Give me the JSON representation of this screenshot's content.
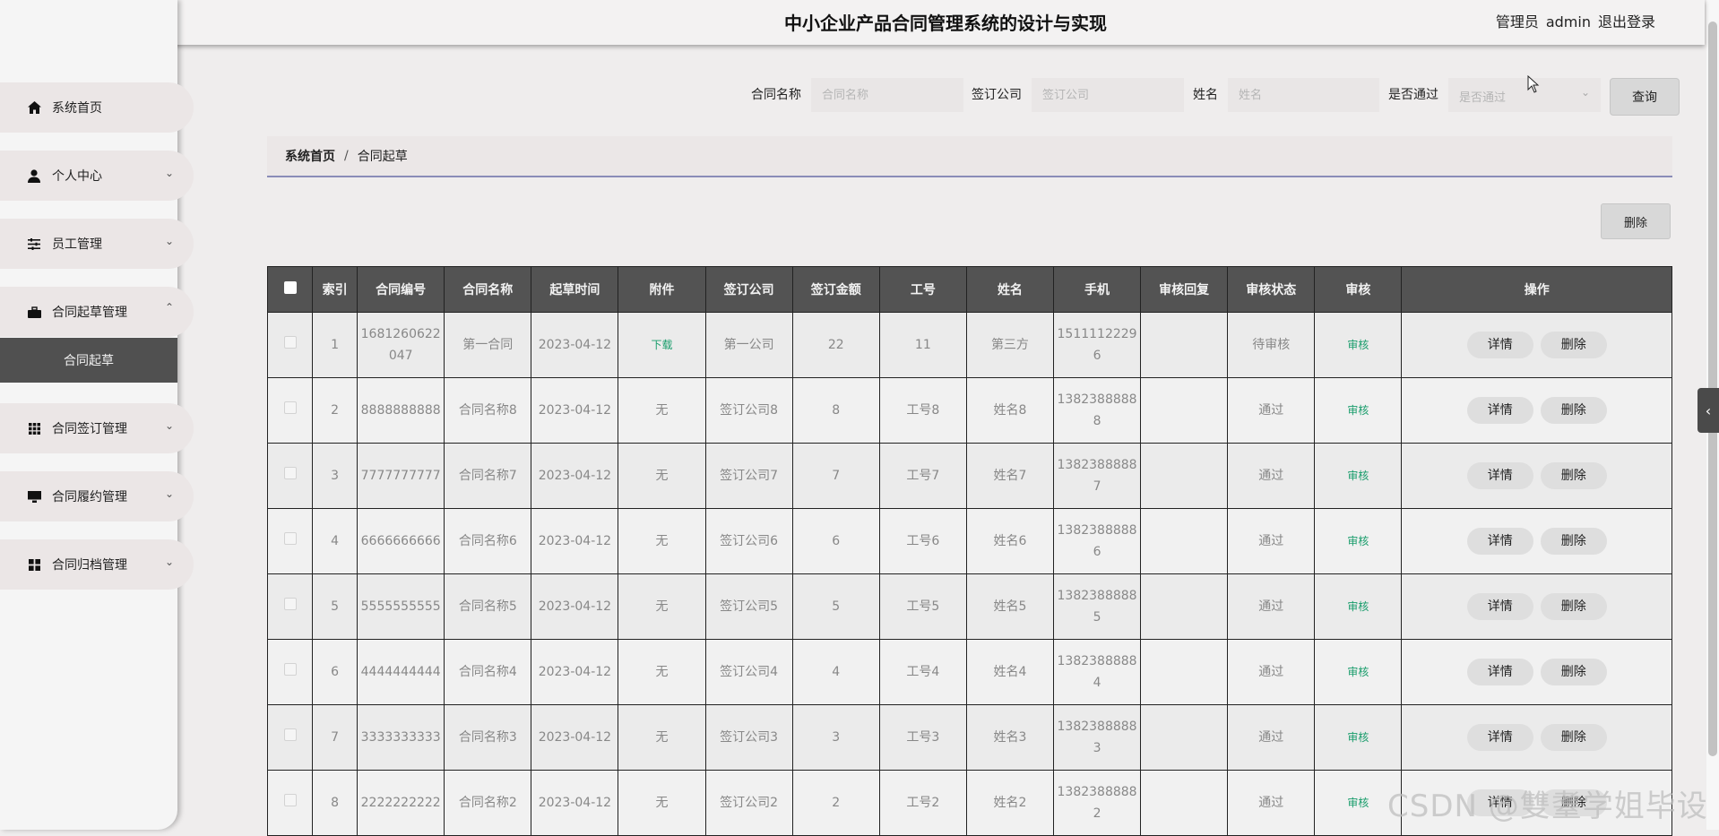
{
  "header": {
    "title": "中小企业产品合同管理系统的设计与实现",
    "user_role": "管理员",
    "user_name": "admin",
    "logout": "退出登录"
  },
  "sidebar": {
    "items": [
      {
        "label": "系统首页",
        "icon": "home-icon"
      },
      {
        "label": "个人中心",
        "icon": "user-icon"
      },
      {
        "label": "员工管理",
        "icon": "sliders-icon"
      },
      {
        "label": "合同起草管理",
        "icon": "briefcase-icon"
      },
      {
        "label": "合同签订管理",
        "icon": "grid-icon"
      },
      {
        "label": "合同履约管理",
        "icon": "monitor-icon"
      },
      {
        "label": "合同归档管理",
        "icon": "apps-icon"
      }
    ],
    "active_sub": "合同起草"
  },
  "search": {
    "contract_name_label": "合同名称",
    "contract_name_placeholder": "合同名称",
    "company_label": "签订公司",
    "company_placeholder": "签订公司",
    "name_label": "姓名",
    "name_placeholder": "姓名",
    "pass_label": "是否通过",
    "pass_placeholder": "是否通过",
    "query_button": "查询"
  },
  "breadcrumb": {
    "home": "系统首页",
    "separator": "/",
    "current": "合同起草"
  },
  "actions": {
    "delete_button": "删除"
  },
  "table": {
    "headers": [
      "索引",
      "合同编号",
      "合同名称",
      "起草时间",
      "附件",
      "签订公司",
      "签订金额",
      "工号",
      "姓名",
      "手机",
      "审核回复",
      "审核状态",
      "审核",
      "操作"
    ],
    "detail_label": "详情",
    "delete_label": "删除",
    "rows": [
      {
        "idx": "1",
        "code": "1681260622047",
        "name": "第一合同",
        "time": "2023-04-12",
        "attach": "下载",
        "company": "第一公司",
        "amount": "22",
        "job": "11",
        "person": "第三方",
        "phone": "15111122296",
        "reply": "",
        "status": "待审核",
        "audit": "审核"
      },
      {
        "idx": "2",
        "code": "8888888888",
        "name": "合同名称8",
        "time": "2023-04-12",
        "attach": "无",
        "company": "签订公司8",
        "amount": "8",
        "job": "工号8",
        "person": "姓名8",
        "phone": "13823888888",
        "reply": "",
        "status": "通过",
        "audit": "审核"
      },
      {
        "idx": "3",
        "code": "7777777777",
        "name": "合同名称7",
        "time": "2023-04-12",
        "attach": "无",
        "company": "签订公司7",
        "amount": "7",
        "job": "工号7",
        "person": "姓名7",
        "phone": "13823888887",
        "reply": "",
        "status": "通过",
        "audit": "审核"
      },
      {
        "idx": "4",
        "code": "6666666666",
        "name": "合同名称6",
        "time": "2023-04-12",
        "attach": "无",
        "company": "签订公司6",
        "amount": "6",
        "job": "工号6",
        "person": "姓名6",
        "phone": "13823888886",
        "reply": "",
        "status": "通过",
        "audit": "审核"
      },
      {
        "idx": "5",
        "code": "5555555555",
        "name": "合同名称5",
        "time": "2023-04-12",
        "attach": "无",
        "company": "签订公司5",
        "amount": "5",
        "job": "工号5",
        "person": "姓名5",
        "phone": "13823888885",
        "reply": "",
        "status": "通过",
        "audit": "审核"
      },
      {
        "idx": "6",
        "code": "4444444444",
        "name": "合同名称4",
        "time": "2023-04-12",
        "attach": "无",
        "company": "签订公司4",
        "amount": "4",
        "job": "工号4",
        "person": "姓名4",
        "phone": "13823888884",
        "reply": "",
        "status": "通过",
        "audit": "审核"
      },
      {
        "idx": "7",
        "code": "3333333333",
        "name": "合同名称3",
        "time": "2023-04-12",
        "attach": "无",
        "company": "签订公司3",
        "amount": "3",
        "job": "工号3",
        "person": "姓名3",
        "phone": "13823888883",
        "reply": "",
        "status": "通过",
        "audit": "审核"
      },
      {
        "idx": "8",
        "code": "2222222222",
        "name": "合同名称2",
        "time": "2023-04-12",
        "attach": "无",
        "company": "签订公司2",
        "amount": "2",
        "job": "工号2",
        "person": "姓名2",
        "phone": "13823888882",
        "reply": "",
        "status": "通过",
        "audit": "审核"
      }
    ]
  },
  "watermark": "CSDN @雙耋学姐毕设",
  "colors": {
    "header_bg": "#535353",
    "active_menu": "#505050",
    "link": "#1a9d6c",
    "breadcrumb_line": "#8a8cb8"
  }
}
